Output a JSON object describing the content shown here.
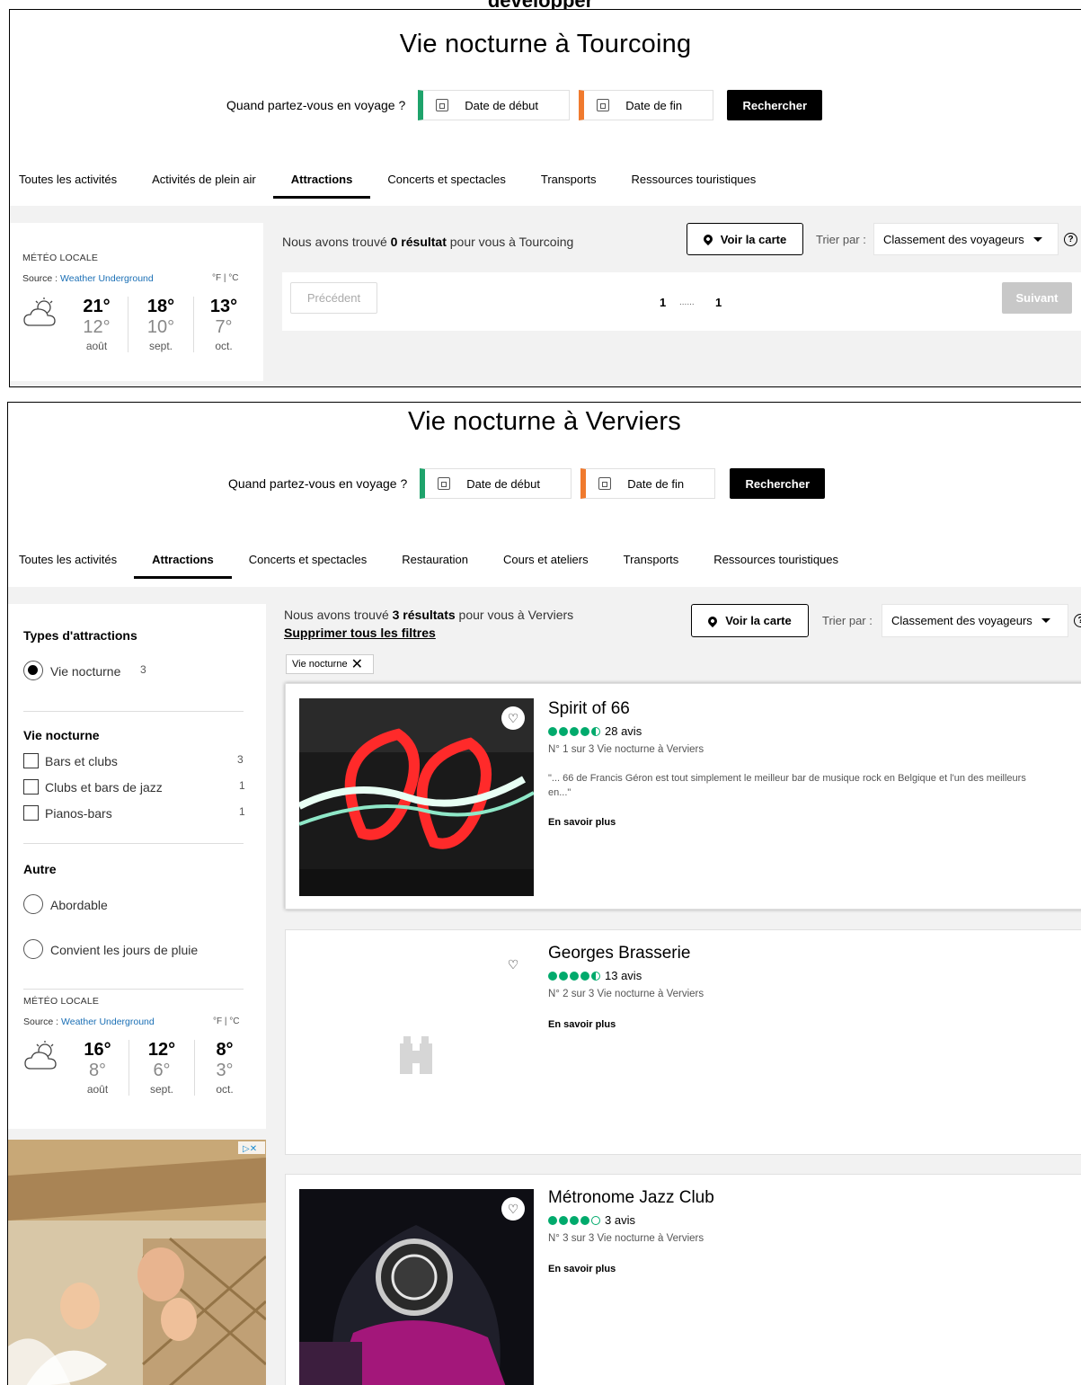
{
  "caption": "développer",
  "panel1": {
    "title": "Vie nocturne à Tourcoing",
    "when_question": "Quand partez-vous en voyage ?",
    "start_date": "Date de début",
    "end_date": "Date de fin",
    "search_btn": "Rechercher",
    "tabs": [
      "Toutes les activités",
      "Activités de plein air",
      "Attractions",
      "Concerts et spectacles",
      "Transports",
      "Ressources touristiques"
    ],
    "weather": {
      "label": "MÉTÉO LOCALE",
      "source_prefix": "Source : ",
      "source_link": "Weather Underground",
      "units": "°F  |  °C",
      "months": [
        {
          "high": "21°",
          "low": "12°",
          "name": "août"
        },
        {
          "high": "18°",
          "low": "10°",
          "name": "sept."
        },
        {
          "high": "13°",
          "low": "7°",
          "name": "oct."
        }
      ]
    },
    "found_pre": "Nous avons trouvé ",
    "found_bold": "0 résultat",
    "found_post": " pour vous à Tourcoing",
    "map_btn": "Voir la carte",
    "sort_label": "Trier par :",
    "sort_value": "Classement des voyageurs",
    "prev": "Précédent",
    "next": "Suivant",
    "page_first": "1",
    "page_dots": "......",
    "page_last": "1"
  },
  "panel2": {
    "title": "Vie nocturne à Verviers",
    "when_question": "Quand partez-vous en voyage ?",
    "start_date": "Date de début",
    "end_date": "Date de fin",
    "search_btn": "Rechercher",
    "tabs": [
      "Toutes les activités",
      "Attractions",
      "Concerts et spectacles",
      "Restauration",
      "Cours et ateliers",
      "Transports",
      "Ressources touristiques"
    ],
    "filters": {
      "types_head": "Types d'attractions",
      "types_option": "Vie nocturne",
      "types_count": "3",
      "night_head": "Vie nocturne",
      "night_items": [
        {
          "label": "Bars et clubs",
          "count": "3"
        },
        {
          "label": "Clubs et bars de jazz",
          "count": "1"
        },
        {
          "label": "Pianos-bars",
          "count": "1"
        }
      ],
      "other_head": "Autre",
      "other_items": [
        "Abordable",
        "Convient les jours de pluie"
      ]
    },
    "weather": {
      "label": "MÉTÉO LOCALE",
      "source_prefix": "Source : ",
      "source_link": "Weather Underground",
      "units": "°F  |  °C",
      "months": [
        {
          "high": "16°",
          "low": "8°",
          "name": "août"
        },
        {
          "high": "12°",
          "low": "6°",
          "name": "sept."
        },
        {
          "high": "8°",
          "low": "3°",
          "name": "oct."
        }
      ]
    },
    "found_pre": "Nous avons trouvé ",
    "found_bold": "3 résultats",
    "found_post": " pour vous à Verviers",
    "clear_filters": "Supprimer tous les filtres",
    "chip": "Vie nocturne",
    "map_btn": "Voir la carte",
    "sort_label": "Trier par :",
    "sort_value": "Classement des voyageurs",
    "results": [
      {
        "title": "Spirit of 66",
        "rating": 4.5,
        "reviews": "28 avis",
        "rank": "N° 1 sur 3 Vie nocturne à Verviers",
        "quote": "\"... 66 de Francis Géron est tout simplement le meilleur bar de musique rock en Belgique et l'un des meilleurs en...\"",
        "more": "En savoir plus"
      },
      {
        "title": "Georges Brasserie",
        "rating": 4.5,
        "reviews": "13 avis",
        "rank": "N° 2 sur 3 Vie nocturne à Verviers",
        "more": "En savoir plus"
      },
      {
        "title": "Métronome Jazz Club",
        "rating": 4,
        "reviews": "3 avis",
        "rank": "N° 3 sur 3 Vie nocturne à Verviers",
        "more": "En savoir plus"
      }
    ]
  },
  "colors": {
    "start_accent": "#1ea36b",
    "end_accent": "#f07a2e",
    "bubble": "#00aa6c",
    "link": "#1a6fb5"
  }
}
